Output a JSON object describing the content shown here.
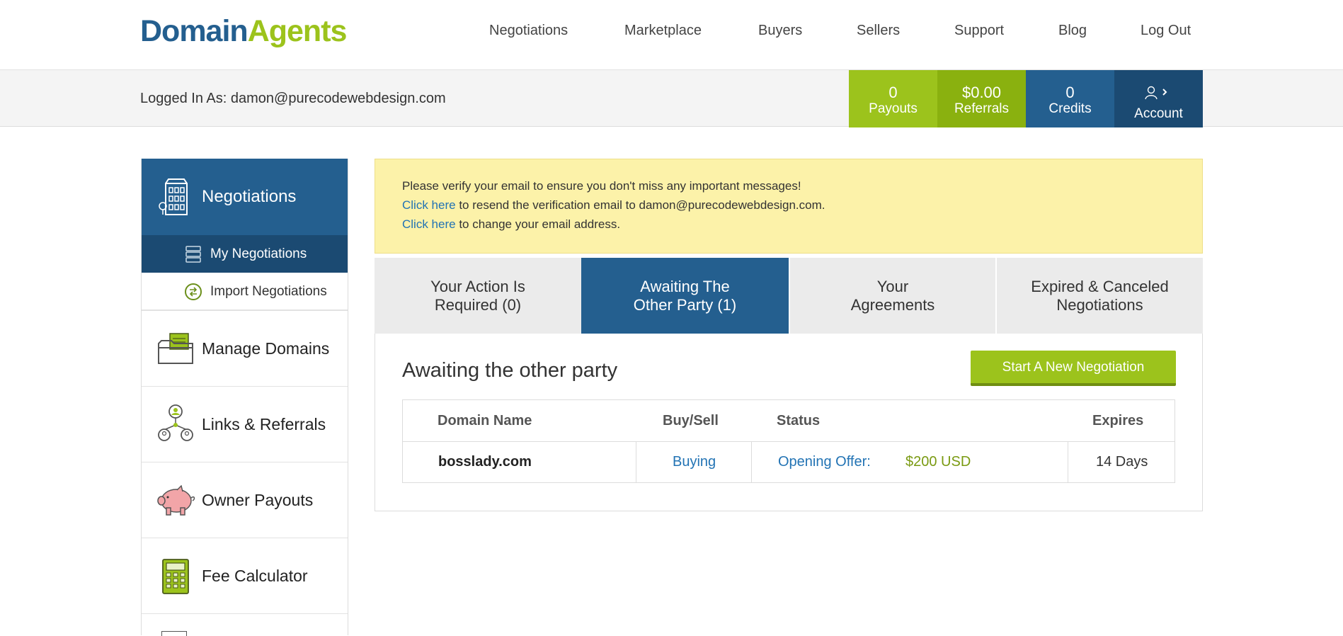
{
  "header": {
    "logo_part1": "Domain",
    "logo_part2": "Agents",
    "nav": [
      "Negotiations",
      "Marketplace",
      "Buyers",
      "Sellers",
      "Support",
      "Blog",
      "Log Out"
    ]
  },
  "subbar": {
    "logged_in": "Logged In As: damon@purecodewebdesign.com",
    "payouts": {
      "value": "0",
      "label": "Payouts"
    },
    "referrals": {
      "value": "$0.00",
      "label": "Referrals"
    },
    "credits": {
      "value": "0",
      "label": "Credits"
    },
    "account": {
      "label": "Account",
      "icon": "user-icon"
    }
  },
  "sidebar": {
    "header": {
      "label": "Negotiations",
      "icon": "building-icon"
    },
    "subitems": [
      {
        "label": "My Negotiations",
        "icon": "list-icon"
      },
      {
        "label": "Import Negotiations",
        "icon": "import-icon"
      }
    ],
    "items": [
      {
        "label": "Manage Domains",
        "icon": "folder-icon"
      },
      {
        "label": "Links & Referrals",
        "icon": "network-icon"
      },
      {
        "label": "Owner Payouts",
        "icon": "piggy-bank-icon"
      },
      {
        "label": "Fee Calculator",
        "icon": "calculator-icon"
      }
    ]
  },
  "alert": {
    "line1": "Please verify your email to ensure you don't miss any important messages!",
    "line2_link": "Click here",
    "line2_text": " to resend the verification email to damon@purecodewebdesign.com.",
    "line3_link": "Click here",
    "line3_text": " to change your email address."
  },
  "tabs": [
    {
      "line1": "Your Action Is",
      "line2": "Required (0)"
    },
    {
      "line1": "Awaiting The",
      "line2": "Other Party (1)"
    },
    {
      "line1": "Your",
      "line2": "Agreements"
    },
    {
      "line1": "Expired & Canceled",
      "line2": "Negotiations"
    }
  ],
  "panel": {
    "title": "Awaiting the other party",
    "new_button": "Start A New Negotiation",
    "columns": [
      "Domain Name",
      "Buy/Sell",
      "Status",
      "Expires"
    ],
    "rows": [
      {
        "domain": "bosslady.com",
        "type": "Buying",
        "status_label": "Opening Offer:",
        "status_value": "$200 USD",
        "expires": "14 Days"
      }
    ]
  },
  "colors": {
    "brand_blue": "#245f8f",
    "brand_green": "#9cc31c",
    "alert_bg": "#fcf2a9"
  }
}
